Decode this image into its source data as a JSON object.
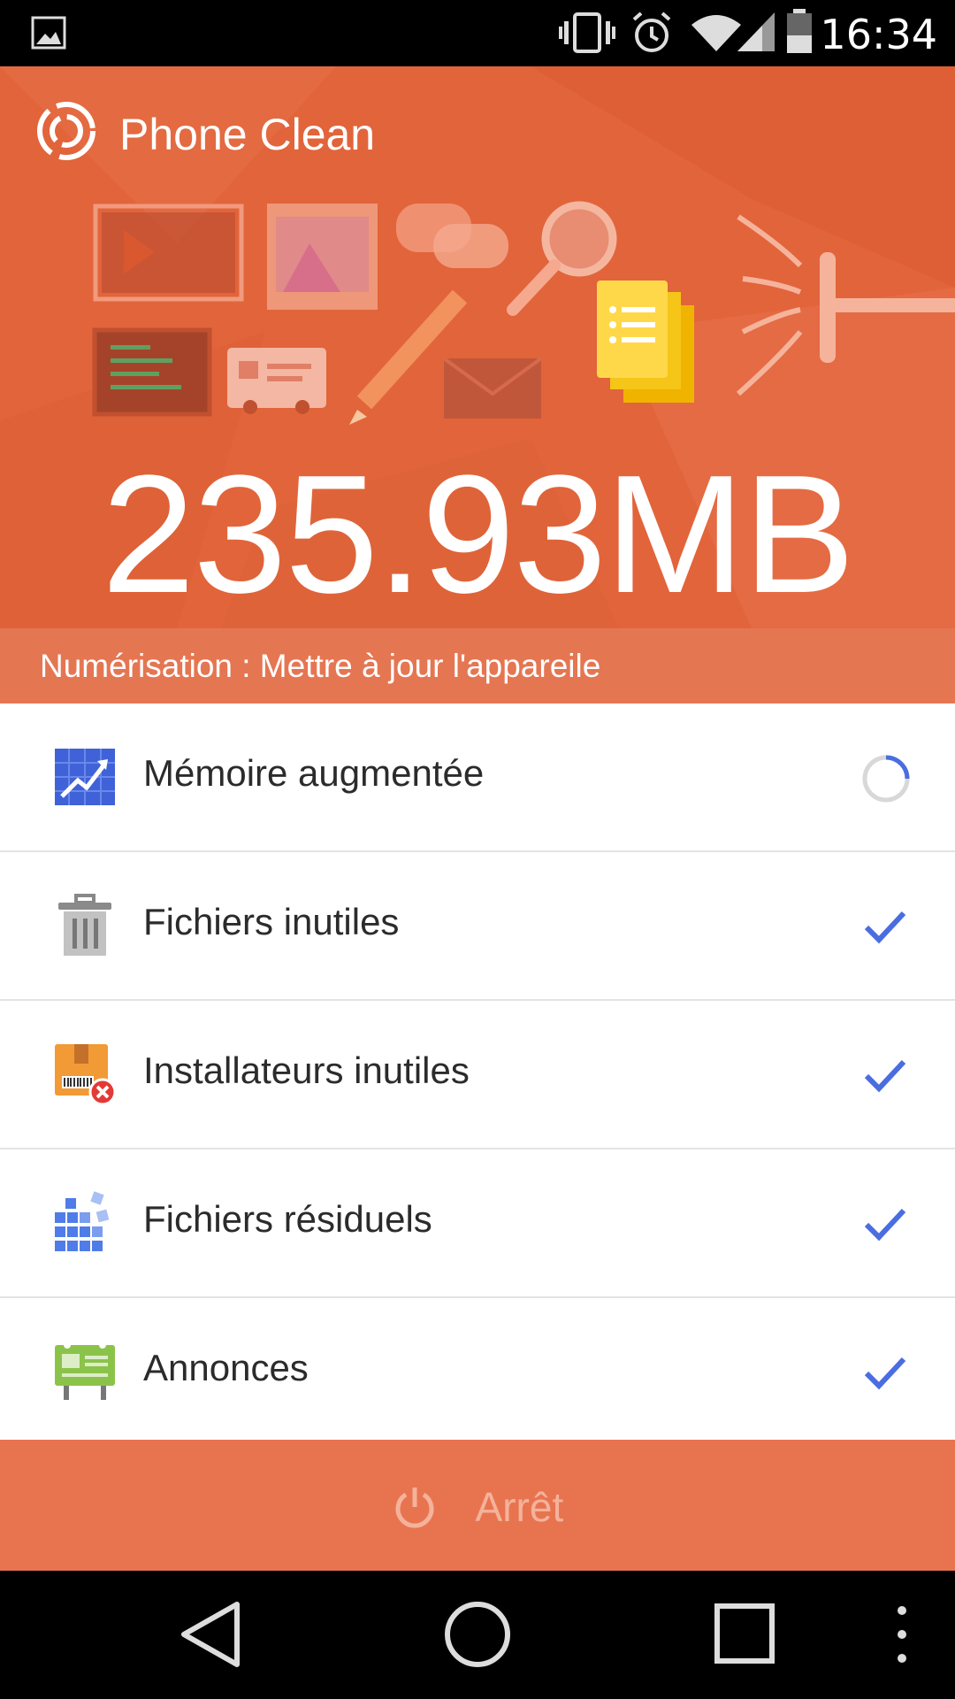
{
  "status_bar": {
    "time": "16:34",
    "icons": [
      "image-icon",
      "vibrate-icon",
      "alarm-icon",
      "wifi-icon",
      "signal-icon",
      "battery-icon"
    ]
  },
  "header": {
    "app_name": "Phone Clean",
    "logo_icon": "phone-clean-logo-icon"
  },
  "hero": {
    "size_value": "235.93MB",
    "scan_status": "Numérisation : Mettre à jour l'appareile",
    "accent_color": "#e2643b"
  },
  "items": [
    {
      "label": "Mémoire augmentée",
      "icon": "memory-chart-icon",
      "state": "loading"
    },
    {
      "label": "Fichiers inutiles",
      "icon": "trash-icon",
      "state": "done"
    },
    {
      "label": "Installateurs inutiles",
      "icon": "package-icon",
      "state": "done"
    },
    {
      "label": "Fichiers résiduels",
      "icon": "residual-blocks-icon",
      "state": "done"
    },
    {
      "label": "Annonces",
      "icon": "billboard-icon",
      "state": "done"
    }
  ],
  "stop_button": {
    "label": "Arrêt",
    "icon": "power-icon"
  },
  "nav": {
    "buttons": [
      "back-icon",
      "home-icon",
      "recents-icon",
      "more-icon"
    ]
  }
}
